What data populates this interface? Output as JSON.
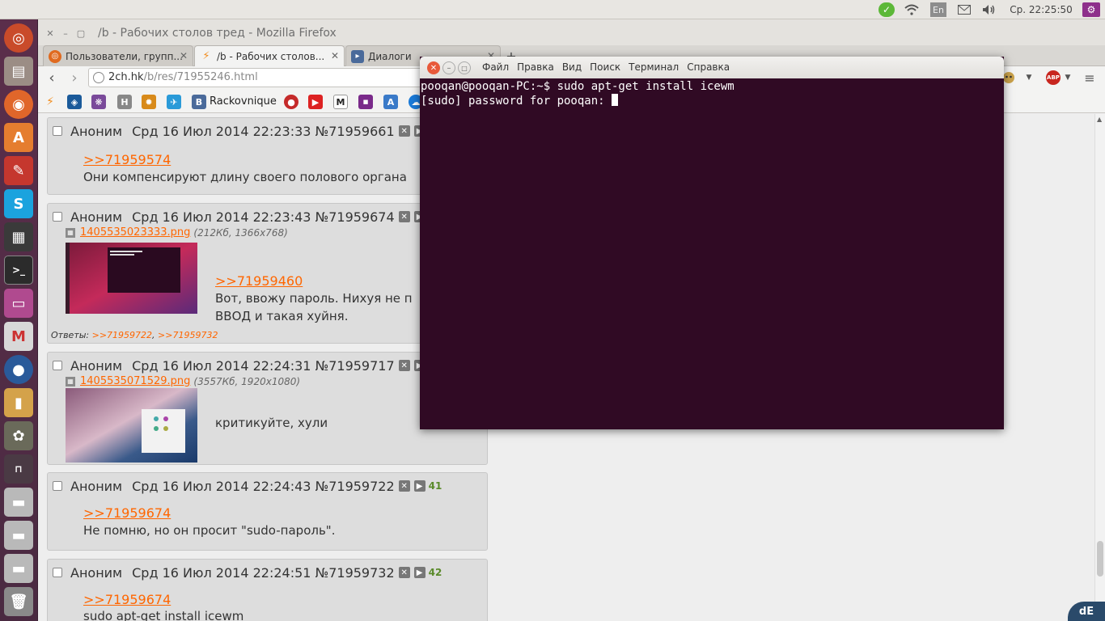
{
  "top_panel": {
    "keyboard_layout": "En",
    "clock": "Ср. 22:25:50"
  },
  "launcher": {
    "items": [
      "ubuntu-home",
      "files",
      "firefox",
      "software-center",
      "system-settings",
      "skype",
      "video-editor",
      "terminal",
      "workspaces",
      "gmail",
      "drop",
      "system-monitor",
      "gimp",
      "usb-drive",
      "drive-1",
      "drive-2",
      "drive-3",
      "trash"
    ]
  },
  "firefox": {
    "window_title": "/b - Рабочих столов тред - Mozilla Firefox",
    "tabs": [
      {
        "label": "Пользователи, групп..."
      },
      {
        "label": "/b  - Рабочих столов..."
      },
      {
        "label": "Диалоги"
      }
    ],
    "url_host": "2ch.hk",
    "url_path": "/b/res/71955246.html",
    "bookmarks": {
      "vk_label": "Rackovnique"
    }
  },
  "posts": [
    {
      "name": "Аноним",
      "date": "Срд 16 Июл 2014 22:23:33",
      "num": "№71959661",
      "reply_to": ">>71959574",
      "text": "Они компенсируют длину своего полового органа"
    },
    {
      "name": "Аноним",
      "date": "Срд 16 Июл 2014 22:23:43",
      "num": "№71959674",
      "file_name": "1405535023333.png",
      "file_meta": "(212Кб, 1366x768)",
      "reply_to": ">>71959460",
      "text_line1": "Вот, ввожу пароль. Нихуя не п",
      "text_line2": "ВВОД и такая хуйня.",
      "answers_label": "Ответы:",
      "answer1": ">>71959722",
      "answer2": ">>71959732"
    },
    {
      "name": "Аноним",
      "date": "Срд 16 Июл 2014 22:24:31",
      "num": "№71959717",
      "file_name": "1405535071529.png",
      "file_meta": "(3557Кб, 1920x1080)",
      "text": "критикуйте, хули"
    },
    {
      "name": "Аноним",
      "date": "Срд 16 Июл 2014 22:24:43",
      "num": "№71959722",
      "post_index": "41",
      "reply_to": ">>71959674",
      "text": "Не помню, но он просит \"sudo-пароль\"."
    },
    {
      "name": "Аноним",
      "date": "Срд 16 Июл 2014 22:24:51",
      "num": "№71959732",
      "post_index": "42",
      "reply_to": ">>71959674",
      "text": "sudo apt-get install icewm"
    }
  ],
  "terminal": {
    "menu": [
      "Файл",
      "Правка",
      "Вид",
      "Поиск",
      "Терминал",
      "Справка"
    ],
    "line1": "pooqan@pooqan-PC:~$ sudo apt-get install icewm",
    "line2": "[sudo] password for pooqan: "
  },
  "colors": {
    "terminal_bg": "#300a24",
    "launcher_bg": "#5b2e4b",
    "link": "#ff6600"
  }
}
